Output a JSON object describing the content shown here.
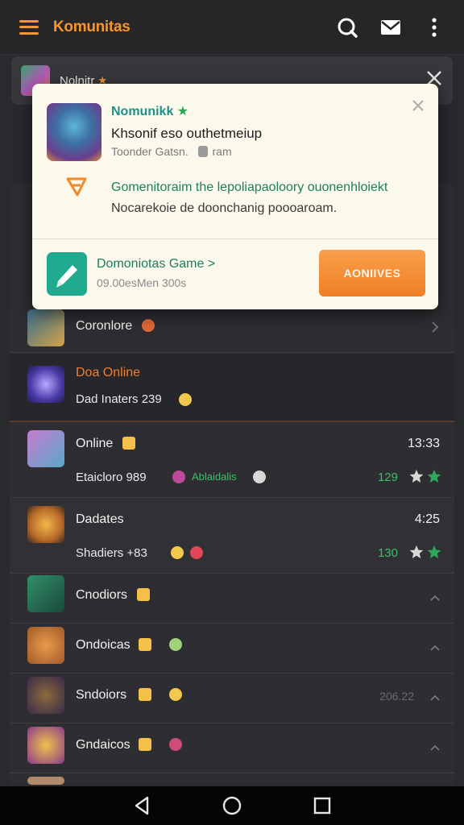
{
  "app": {
    "title": "Komunitas"
  },
  "bg_notification": {
    "name": "Nolnitr",
    "star": "★"
  },
  "card": {
    "app_name": "Nomunikk",
    "star": "★",
    "headline": "Khsoni​f eso outhetmeiup",
    "source": "Toonder Gatsn.",
    "source_extra": "ram",
    "message_line1": "Gomenitoraim the lepoliapaoloory ouonenhloiekt",
    "message_line2": "Nocarekoie de doonchanig poooaroam.",
    "game_name": "Domoniotas Game >",
    "game_time": "09.00esMen 300s",
    "action_label": "AONIIVES"
  },
  "list": [
    {
      "title": "Coronlore",
      "sub": "",
      "meta": "",
      "color": "#e06a3a"
    },
    {
      "title": "Doa Online",
      "sub": "Dad Inaters 239",
      "meta": "",
      "color": "#7a5bd0"
    },
    {
      "title": "Online",
      "sub": "Etaicloro 989",
      "sub_green": "Ablaidalis",
      "meta": "13:33",
      "count": "129",
      "color": "#c67bd0"
    },
    {
      "title": "Dadates",
      "sub": "Shadiers +83",
      "meta": "4:25",
      "count": "130",
      "color": "#d3843a"
    },
    {
      "title": "Cnodiors",
      "sub": "",
      "meta": "",
      "color": "#2f8f6a"
    },
    {
      "title": "Ondoicas",
      "sub": "",
      "meta": "",
      "color": "#c8783b"
    },
    {
      "title": "Sndoiors",
      "sub": "",
      "meta": "206.22",
      "color": "#6b4b8a"
    },
    {
      "title": "Gndaicos",
      "sub": "",
      "meta": "",
      "color": "#b88f2d"
    }
  ],
  "colors": {
    "accent": "#f5962d",
    "green": "#3bbf6b",
    "card_bg": "#fbf8ec"
  }
}
